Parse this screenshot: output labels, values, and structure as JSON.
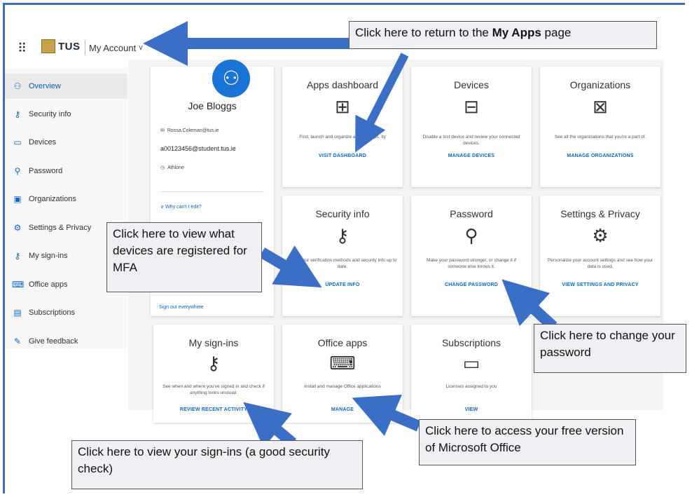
{
  "header": {
    "logo_text": "TUS",
    "app_title": "My Account",
    "chevron": "∨"
  },
  "sidebar": {
    "items": [
      {
        "label": "Overview",
        "icon": "person-icon"
      },
      {
        "label": "Security info",
        "icon": "security-info-icon"
      },
      {
        "label": "Devices",
        "icon": "laptop-icon"
      },
      {
        "label": "Password",
        "icon": "key-icon"
      },
      {
        "label": "Organizations",
        "icon": "briefcase-icon"
      },
      {
        "label": "Settings & Privacy",
        "icon": "gear-icon"
      },
      {
        "label": "My sign-ins",
        "icon": "sign-ins-icon"
      },
      {
        "label": "Office apps",
        "icon": "office-apps-icon"
      },
      {
        "label": "Subscriptions",
        "icon": "card-icon"
      },
      {
        "label": "Give feedback",
        "icon": "feedback-icon"
      }
    ]
  },
  "profile": {
    "name": "Joe Bloggs",
    "email": "Rossa.Coleman@tus.ie",
    "student_id": "a00123456@student.tus.ie",
    "location": "Athlone",
    "why_edit": "Why can't I edit?",
    "sign_out": "Sign out everywhere"
  },
  "cards": {
    "apps": {
      "title": "Apps dashboard",
      "desc": "Find, launch and organize all your apps. ity",
      "link": "VISIT DASHBOARD"
    },
    "devices": {
      "title": "Devices",
      "desc": "Disable a lost device and review your connected devices.",
      "link": "MANAGE DEVICES"
    },
    "orgs": {
      "title": "Organizations",
      "desc": "See all the organizations that you're a part of.",
      "link": "MANAGE ORGANIZATIONS"
    },
    "security": {
      "title": "Security info",
      "desc": "Keep your verification methods and security info up to date.",
      "link": "UPDATE INFO"
    },
    "password": {
      "title": "Password",
      "desc": "Make your password stronger, or change it if someone else knows it.",
      "link": "CHANGE PASSWORD"
    },
    "settings": {
      "title": "Settings & Privacy",
      "desc": "Personalize your account settings and see how your data is used.",
      "link": "VIEW SETTINGS AND PRIVACY"
    },
    "signins": {
      "title": "My sign-ins",
      "desc": "See when and where you've signed in and check if anything looks unusual.",
      "link": "REVIEW RECENT ACTIVITY"
    },
    "office": {
      "title": "Office apps",
      "desc": "Install and manage Office applications",
      "link": "MANAGE"
    },
    "subs": {
      "title": "Subscriptions",
      "desc": "Licenses assigned to you",
      "link": "VIEW"
    }
  },
  "callouts": {
    "my_apps_prefix": "Click here to return to the ",
    "my_apps_bold": "My Apps",
    "my_apps_suffix": " page",
    "mfa": "Click here to view what devices are registered for MFA",
    "password": "Click here to change your password",
    "office": "Click here to access your free version of Microsoft Office",
    "signins": "Click here to view your sign-ins (a good security check)"
  },
  "colors": {
    "accent": "#0b66c3",
    "arrow": "#3b6fc6",
    "avatar": "#1a73d6"
  }
}
